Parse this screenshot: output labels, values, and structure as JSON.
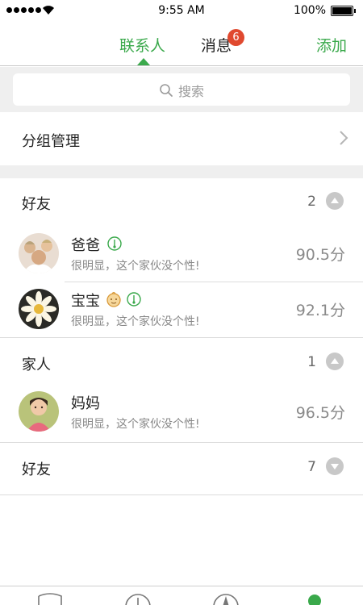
{
  "status": {
    "time": "9:55 AM",
    "battery": "100%"
  },
  "nav": {
    "tab_contacts": "联系人",
    "tab_messages": "消息",
    "messages_badge": "6",
    "add_label": "添加"
  },
  "search": {
    "placeholder": "搜索"
  },
  "group_management": {
    "label": "分组管理"
  },
  "sections": [
    {
      "title": "好友",
      "count": "2",
      "expanded": true
    },
    {
      "title": "家人",
      "count": "1",
      "expanded": true
    },
    {
      "title": "好友",
      "count": "7",
      "expanded": false
    }
  ],
  "contacts": [
    {
      "name": "爸爸",
      "signature": "很明显，这个家伙没个性!",
      "score": "90.5分",
      "icons": [
        "thermometer-icon"
      ]
    },
    {
      "name": "宝宝",
      "signature": "很明显，这个家伙没个性!",
      "score": "92.1分",
      "icons": [
        "baby-face-icon",
        "thermometer-icon"
      ]
    },
    {
      "name": "妈妈",
      "signature": "很明显，这个家伙没个性!",
      "score": "96.5分",
      "icons": []
    }
  ],
  "colors": {
    "accent": "#3aa94b",
    "badge": "#e0492f",
    "band": "#efefef"
  }
}
